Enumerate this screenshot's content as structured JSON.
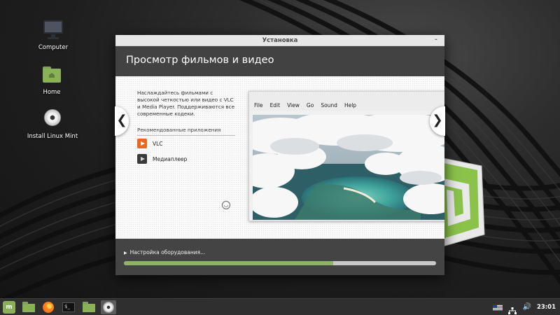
{
  "desktop": {
    "icons": [
      {
        "label": "Computer",
        "icon": "computer-icon"
      },
      {
        "label": "Home",
        "icon": "home-folder-icon"
      },
      {
        "label": "Install Linux Mint",
        "icon": "disc-icon"
      }
    ]
  },
  "window": {
    "title": "Установка",
    "minimize_glyph": "‐",
    "header_title": "Просмотр фильмов и видео",
    "slide": {
      "description": "Наслаждайтесь фильмами с высокой четкостью или видео с VLC и Media Player. Поддерживаются все современные кодеки.",
      "recommended_heading": "Рекомендованные приложения",
      "apps": [
        {
          "label": "VLC",
          "icon": "vlc-icon",
          "color": "#e8691d"
        },
        {
          "label": "Медиаплеер",
          "icon": "media-player-icon",
          "color": "#3a3a3a"
        }
      ],
      "player_menu": [
        "File",
        "Edit",
        "View",
        "Go",
        "Sound",
        "Help"
      ],
      "prev_glyph": "❮",
      "next_glyph": "❯"
    },
    "status_text": "Настройка оборудования...",
    "progress_percent": 67
  },
  "taskbar": {
    "launchers": [
      "mint-menu-icon",
      "folder-icon",
      "firefox-icon",
      "terminal-icon",
      "folder-icon",
      "disc-icon"
    ],
    "terminal_glyph": "$_",
    "mint_glyph": "m",
    "volume_glyph": "🔊",
    "clock": "23:01"
  },
  "colors": {
    "accent": "#8fb466",
    "header_bg": "#424242",
    "footer_bg": "#444444",
    "taskbar_bg": "#2f2f2f"
  }
}
